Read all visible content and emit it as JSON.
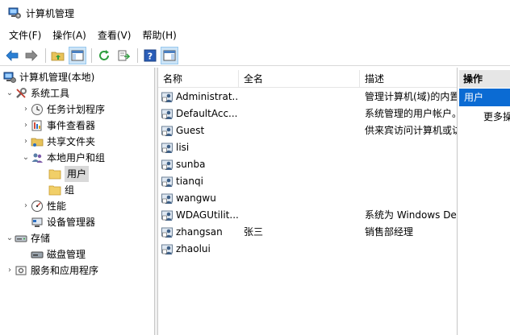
{
  "window": {
    "title": "计算机管理"
  },
  "menu": [
    {
      "label": "文件(F)"
    },
    {
      "label": "操作(A)"
    },
    {
      "label": "查看(V)"
    },
    {
      "label": "帮助(H)"
    }
  ],
  "toolbar": {
    "buttons": [
      "back-icon",
      "forward-icon",
      "up-folder-icon",
      "show-hide-tree-icon",
      "refresh-icon",
      "export-list-icon",
      "help-icon",
      "show-hide-action-pane-icon"
    ]
  },
  "tree": {
    "root": "计算机管理(本地)",
    "system_tools": "系统工具",
    "task_scheduler": "任务计划程序",
    "event_viewer": "事件查看器",
    "shared_folders": "共享文件夹",
    "local_users": "本地用户和组",
    "users": "用户",
    "groups": "组",
    "performance": "性能",
    "device_manager": "设备管理器",
    "storage": "存储",
    "disk_management": "磁盘管理",
    "services": "服务和应用程序"
  },
  "list": {
    "columns": [
      "名称",
      "全名",
      "描述"
    ],
    "rows": [
      {
        "name": "Administrat...",
        "fullname": "",
        "desc": "管理计算机(域)的内置"
      },
      {
        "name": "DefaultAcc...",
        "fullname": "",
        "desc": "系统管理的用户帐户。"
      },
      {
        "name": "Guest",
        "fullname": "",
        "desc": "供来宾访问计算机或访"
      },
      {
        "name": "lisi",
        "fullname": "",
        "desc": ""
      },
      {
        "name": "sunba",
        "fullname": "",
        "desc": ""
      },
      {
        "name": "tianqi",
        "fullname": "",
        "desc": ""
      },
      {
        "name": "wangwu",
        "fullname": "",
        "desc": ""
      },
      {
        "name": "WDAGUtilit...",
        "fullname": "",
        "desc": "系统为 Windows Def"
      },
      {
        "name": "zhangsan",
        "fullname": "张三",
        "desc": "销售部经理"
      },
      {
        "name": "zhaolui",
        "fullname": "",
        "desc": ""
      }
    ]
  },
  "actions": {
    "header": "操作",
    "section": "用户",
    "more": "更多操作"
  },
  "colors": {
    "selection": "#0b6bd3",
    "tree_selected": "#d9d9d9"
  }
}
